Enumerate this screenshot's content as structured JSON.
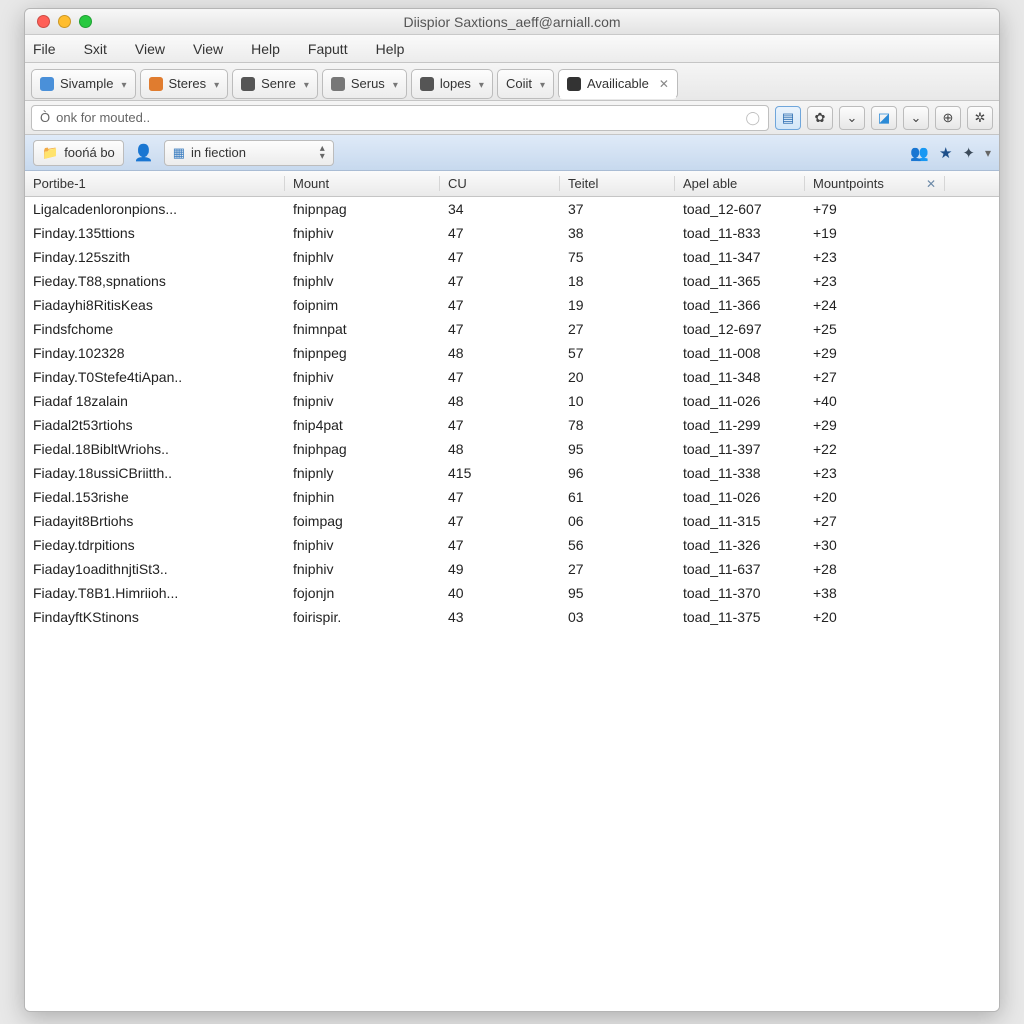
{
  "window": {
    "title": "Diispior Saxtions_aeff@arniall.com"
  },
  "menubar": [
    "File",
    "Sxit",
    "View",
    "View",
    "Help",
    "Faputt",
    "Help"
  ],
  "tabs": [
    {
      "label": "Sivample",
      "iconColor": "#4a90d9",
      "hasDropdown": true
    },
    {
      "label": "Steres",
      "iconColor": "#e07c2f",
      "hasDropdown": true
    },
    {
      "label": "Senre",
      "iconColor": "#555",
      "hasDropdown": true
    },
    {
      "label": "Serus",
      "iconColor": "#777",
      "hasDropdown": true
    },
    {
      "label": "lopes",
      "iconColor": "#555",
      "hasDropdown": true
    },
    {
      "label": "Coiit",
      "iconColor": "",
      "hasDropdown": true
    },
    {
      "label": "Availicable",
      "iconColor": "#333",
      "active": true,
      "closable": true
    }
  ],
  "search": {
    "placeholder": "onk for mouted.."
  },
  "toolbar": {
    "browse_label": "foońá bo",
    "select_label": "in fiection"
  },
  "columns": [
    "Portibe-1",
    "Mount",
    "CU",
    "Teitel",
    "Apel able",
    "Mountpoints"
  ],
  "rows": [
    {
      "c0": "Ligalcadenloronpions...",
      "c1": "fnipnpag",
      "c2": "34",
      "c3": "37",
      "c4": "toad_12-607",
      "c5": "+79"
    },
    {
      "c0": "Finday.135ttions",
      "c1": "fniphiv",
      "c2": "47",
      "c3": "38",
      "c4": "toad_11-833",
      "c5": "+19"
    },
    {
      "c0": "Finday.125szith",
      "c1": "fniphlv",
      "c2": "47",
      "c3": "75",
      "c4": "toad_11-347",
      "c5": "+23"
    },
    {
      "c0": "Fieday.T88,spnations",
      "c1": "fniphlv",
      "c2": "47",
      "c3": "18",
      "c4": "toad_11-365",
      "c5": "+23"
    },
    {
      "c0": "Fiadayhi8RitisKeas",
      "c1": "foipnim",
      "c2": "47",
      "c3": "19",
      "c4": "toad_11-366",
      "c5": "+24"
    },
    {
      "c0": "Findsfchome",
      "c1": "fnimnpat",
      "c2": "47",
      "c3": "27",
      "c4": "toad_12-697",
      "c5": "+25"
    },
    {
      "c0": "Finday.102328",
      "c1": "fnipnpeg",
      "c2": "48",
      "c3": "57",
      "c4": "toad_11-008",
      "c5": "+29"
    },
    {
      "c0": "Finday.T0Stefe4tiApan..",
      "c1": "fniphiv",
      "c2": "47",
      "c3": "20",
      "c4": "toad_11-348",
      "c5": "+27"
    },
    {
      "c0": "Fiadaf 18zalain",
      "c1": "fnipniv",
      "c2": "48",
      "c3": "10",
      "c4": "toad_11-026",
      "c5": "+40"
    },
    {
      "c0": "Fiadal2t53rtiohs",
      "c1": "fnip4pat",
      "c2": "47",
      "c3": "78",
      "c4": "toad_11-299",
      "c5": "+29"
    },
    {
      "c0": "Fiedal.18BibltWriohs..",
      "c1": "fniphpag",
      "c2": "48",
      "c3": "95",
      "c4": "toad_11-397",
      "c5": "+22"
    },
    {
      "c0": "Fiaday.18ussiCBriitth..",
      "c1": "fnipnly",
      "c2": "415",
      "c3": "96",
      "c4": "toad_11-338",
      "c5": "+23"
    },
    {
      "c0": "Fiedal.153rishe",
      "c1": "fniphin",
      "c2": "47",
      "c3": "61",
      "c4": "toad_11-026",
      "c5": "+20"
    },
    {
      "c0": "Fiadayit8Brtiohs",
      "c1": "foimpag",
      "c2": "47",
      "c3": "06",
      "c4": "toad_11-315",
      "c5": "+27"
    },
    {
      "c0": "Fieday.tdrpitions",
      "c1": "fniphiv",
      "c2": "47",
      "c3": "56",
      "c4": "toad_11-326",
      "c5": "+30"
    },
    {
      "c0": "Fiaday1oadithnjtiSt3..",
      "c1": "fniphiv",
      "c2": "49",
      "c3": "27",
      "c4": "toad_11-637",
      "c5": "+28"
    },
    {
      "c0": "Fiaday.T8B1.Himriioh...",
      "c1": "fojonjn",
      "c2": "40",
      "c3": "95",
      "c4": "toad_11-370",
      "c5": "+38"
    },
    {
      "c0": "FindayftKStinons",
      "c1": "foirispir.",
      "c2": "43",
      "c3": "03",
      "c4": "toad_11-375",
      "c5": "+20"
    }
  ]
}
